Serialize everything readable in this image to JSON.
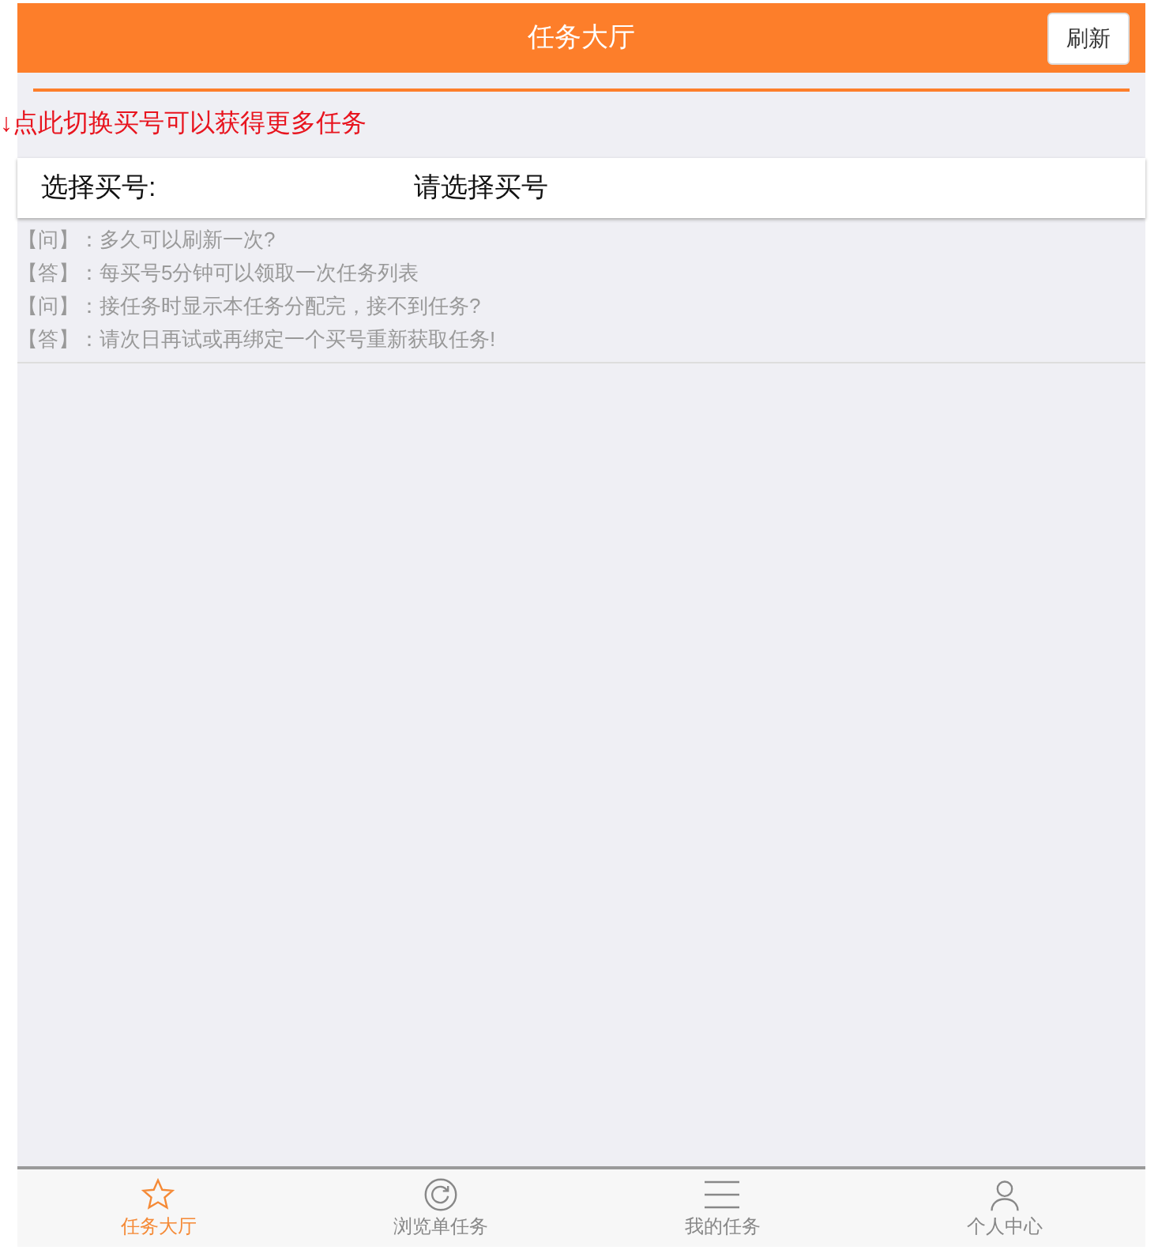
{
  "header": {
    "title": "任务大厅",
    "refresh_button": "刷新"
  },
  "hint": "↓点此切换买号可以获得更多任务",
  "account_select": {
    "label": "选择买号:",
    "placeholder": "请选择买号"
  },
  "faq": [
    "【问】：多久可以刷新一次?",
    "【答】：每买号5分钟可以领取一次任务列表",
    "【问】：接任务时显示本任务分配完，接不到任务?",
    "【答】：请次日再试或再绑定一个买号重新获取任务!"
  ],
  "tabs": [
    {
      "label": "任务大厅",
      "kind": "star",
      "selected": true
    },
    {
      "label": "浏览单任务",
      "kind": "refresh",
      "selected": false
    },
    {
      "label": "我的任务",
      "kind": "list",
      "selected": false
    },
    {
      "label": "个人中心",
      "kind": "user",
      "selected": false
    }
  ]
}
